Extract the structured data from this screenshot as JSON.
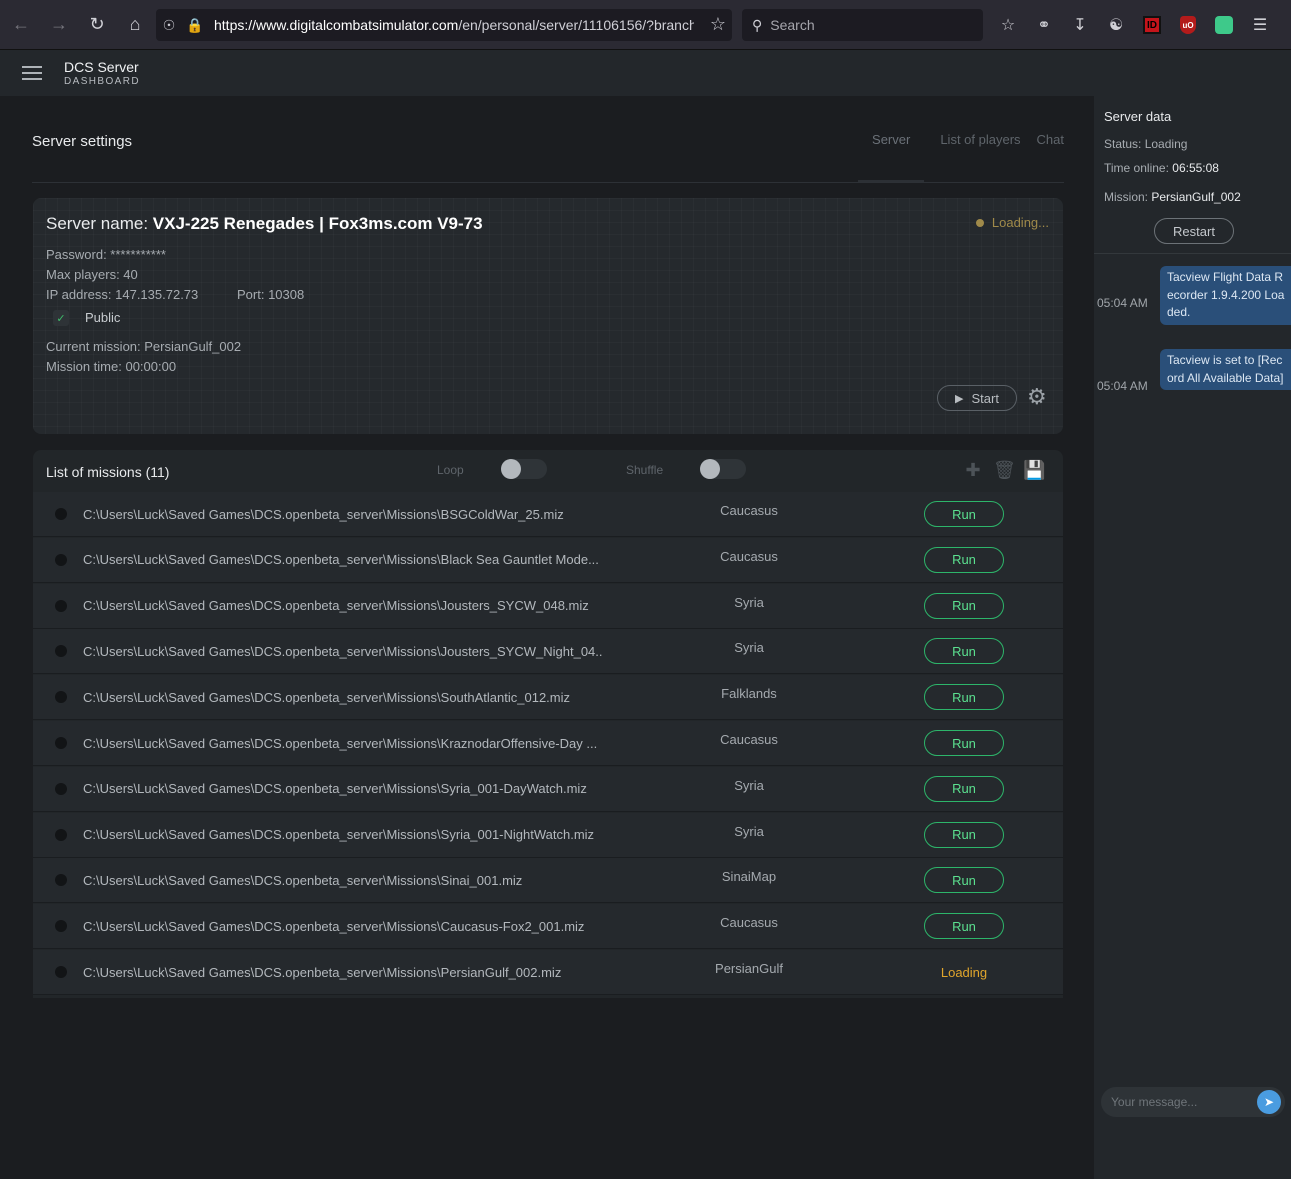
{
  "browser": {
    "url_host": "https://www.digitalcombatsimulator.com",
    "url_path": "/en/personal/server/11106156/?branch",
    "search_placeholder": "Search"
  },
  "header": {
    "title": "DCS Server",
    "subtitle": "DASHBOARD"
  },
  "settings": {
    "title": "Server settings",
    "tabs": [
      "Server",
      "List of players",
      "Chat"
    ]
  },
  "server": {
    "name_label": "Server name:",
    "name": "VXJ-225 Renegades | Fox3ms.com V9-73",
    "status": "Loading...",
    "password": "Password: ***********",
    "max_players": "Max players: 40",
    "ip": "IP address: 147.135.72.73",
    "port": "Port: 10308",
    "public_label": "Public",
    "current_mission": "Current mission: PersianGulf_002",
    "mission_time": "Mission time: 00:00:00",
    "start_label": "Start"
  },
  "missions": {
    "title": "List of missions (11)",
    "loop_label": "Loop",
    "shuffle_label": "Shuffle",
    "run_label": "Run",
    "loading_label": "Loading",
    "rows": [
      {
        "path": "C:\\Users\\Luck\\Saved Games\\DCS.openbeta_server\\Missions\\BSGColdWar_25.miz",
        "map": "Caucasus",
        "state": "run"
      },
      {
        "path": "C:\\Users\\Luck\\Saved Games\\DCS.openbeta_server\\Missions\\Black Sea Gauntlet Mode...",
        "map": "Caucasus",
        "state": "run"
      },
      {
        "path": "C:\\Users\\Luck\\Saved Games\\DCS.openbeta_server\\Missions\\Jousters_SYCW_048.miz",
        "map": "Syria",
        "state": "run"
      },
      {
        "path": "C:\\Users\\Luck\\Saved Games\\DCS.openbeta_server\\Missions\\Jousters_SYCW_Night_04...",
        "map": "Syria",
        "state": "run"
      },
      {
        "path": "C:\\Users\\Luck\\Saved Games\\DCS.openbeta_server\\Missions\\SouthAtlantic_012.miz",
        "map": "Falklands",
        "state": "run"
      },
      {
        "path": "C:\\Users\\Luck\\Saved Games\\DCS.openbeta_server\\Missions\\KraznodarOffensive-Day ...",
        "map": "Caucasus",
        "state": "run"
      },
      {
        "path": "C:\\Users\\Luck\\Saved Games\\DCS.openbeta_server\\Missions\\Syria_001-DayWatch.miz",
        "map": "Syria",
        "state": "run"
      },
      {
        "path": "C:\\Users\\Luck\\Saved Games\\DCS.openbeta_server\\Missions\\Syria_001-NightWatch.miz",
        "map": "Syria",
        "state": "run"
      },
      {
        "path": "C:\\Users\\Luck\\Saved Games\\DCS.openbeta_server\\Missions\\Sinai_001.miz",
        "map": "SinaiMap",
        "state": "run"
      },
      {
        "path": "C:\\Users\\Luck\\Saved Games\\DCS.openbeta_server\\Missions\\Caucasus-Fox2_001.miz",
        "map": "Caucasus",
        "state": "run"
      },
      {
        "path": "C:\\Users\\Luck\\Saved Games\\DCS.openbeta_server\\Missions\\PersianGulf_002.miz",
        "map": "PersianGulf",
        "state": "loading"
      }
    ]
  },
  "side": {
    "title": "Server data",
    "status_label": "Status:",
    "status_value": "Loading",
    "time_label": "Time online:",
    "time_value": "06:55:08",
    "mission_label": "Mission:",
    "mission_value": "PersianGulf_002",
    "restart_label": "Restart",
    "chat": [
      {
        "time": "05:04 AM",
        "text": "Tacview Flight Data Recorder 1.9.4.200 Loaded."
      },
      {
        "time": "05:04 AM",
        "text": "Tacview is set to [Record All Available Data]"
      }
    ],
    "message_placeholder": "Your message..."
  },
  "colors": {
    "run_green": "#5be08f",
    "loading_amber": "#e0a52c",
    "chat_bubble": "#2a4f79"
  }
}
